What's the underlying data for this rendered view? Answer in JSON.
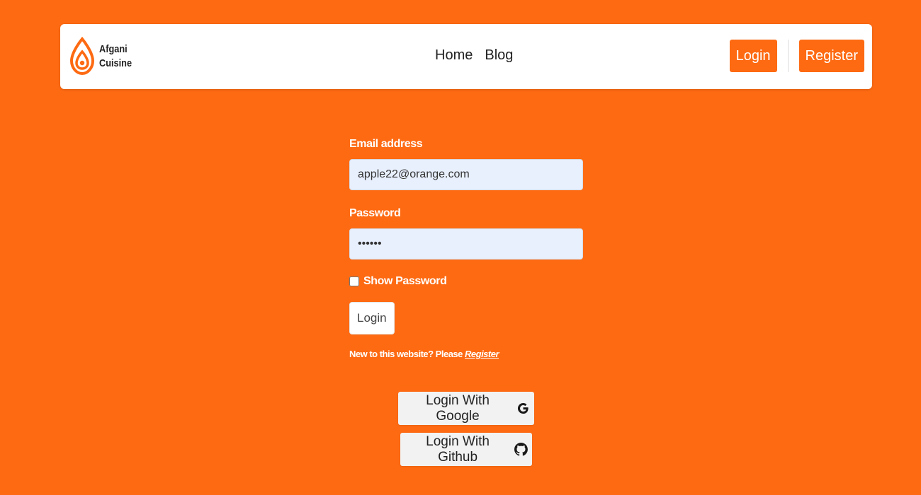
{
  "brand": {
    "name_line1": "Afgani",
    "name_line2": "Cuisine",
    "logo_icon": "flame-drop-icon"
  },
  "nav": {
    "links": [
      "Home",
      "Blog"
    ],
    "login_label": "Login",
    "register_label": "Register"
  },
  "form": {
    "email_label": "Email address",
    "email_value": "apple22@orange.com",
    "password_label": "Password",
    "password_value": "123456",
    "show_password_label": "Show Password",
    "show_password_checked": false,
    "submit_label": "Login",
    "register_prompt": "New to this website? Please",
    "register_link": "Register"
  },
  "social": {
    "google_label": "Login With Google",
    "google_icon": "google-icon",
    "github_label": "Login With Github",
    "github_icon": "github-icon"
  },
  "colors": {
    "accent": "#fd6a12",
    "navbar_bg": "#ffffff",
    "input_bg": "#e8f0fe",
    "social_bg": "#f2f2f2"
  }
}
